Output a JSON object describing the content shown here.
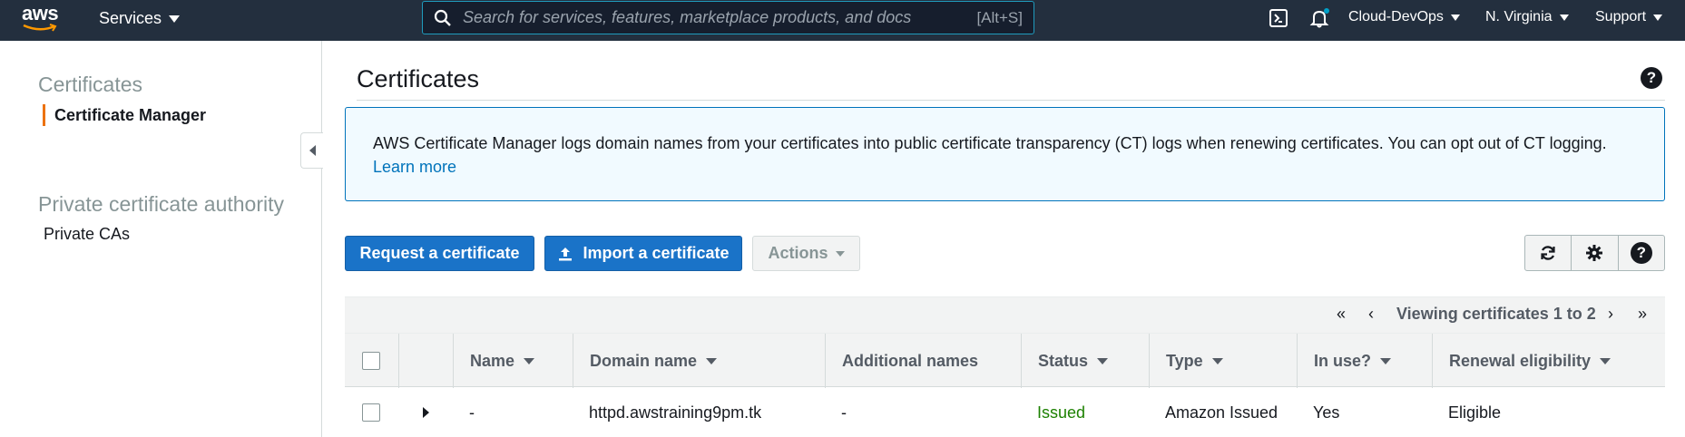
{
  "topnav": {
    "logo_text": "aws",
    "services_label": "Services",
    "search_placeholder": "Search for services, features, marketplace products, and docs",
    "search_shortcut": "[Alt+S]",
    "account_label": "Cloud-DevOps",
    "region_label": "N. Virginia",
    "support_label": "Support"
  },
  "sidebar": {
    "section1_heading": "Certificates",
    "section1_active_item": "Certificate Manager",
    "section2_heading": "Private certificate authority",
    "section2_item": "Private CAs"
  },
  "main": {
    "title": "Certificates",
    "info_text": "AWS Certificate Manager logs domain names from your certificates into public certificate transparency (CT) logs when renewing certificates. You can opt out of CT logging.",
    "info_link": "Learn more",
    "request_button": "Request a certificate",
    "import_button": "Import a certificate",
    "actions_button": "Actions"
  },
  "table": {
    "pagination_text": "Viewing certificates 1 to 2",
    "columns": [
      "Name",
      "Domain name",
      "Additional names",
      "Status",
      "Type",
      "In use?",
      "Renewal eligibility"
    ],
    "rows": [
      {
        "name": "-",
        "domain": "httpd.awstraining9pm.tk",
        "additional": "-",
        "status": "Issued",
        "type": "Amazon Issued",
        "in_use": "Yes",
        "renewal": "Eligible"
      }
    ]
  },
  "colors": {
    "nav_bg": "#232f3e",
    "primary_button": "#1a73c8",
    "status_issued": "#1d8102",
    "link": "#0073bb",
    "active_marker": "#ec7211"
  }
}
